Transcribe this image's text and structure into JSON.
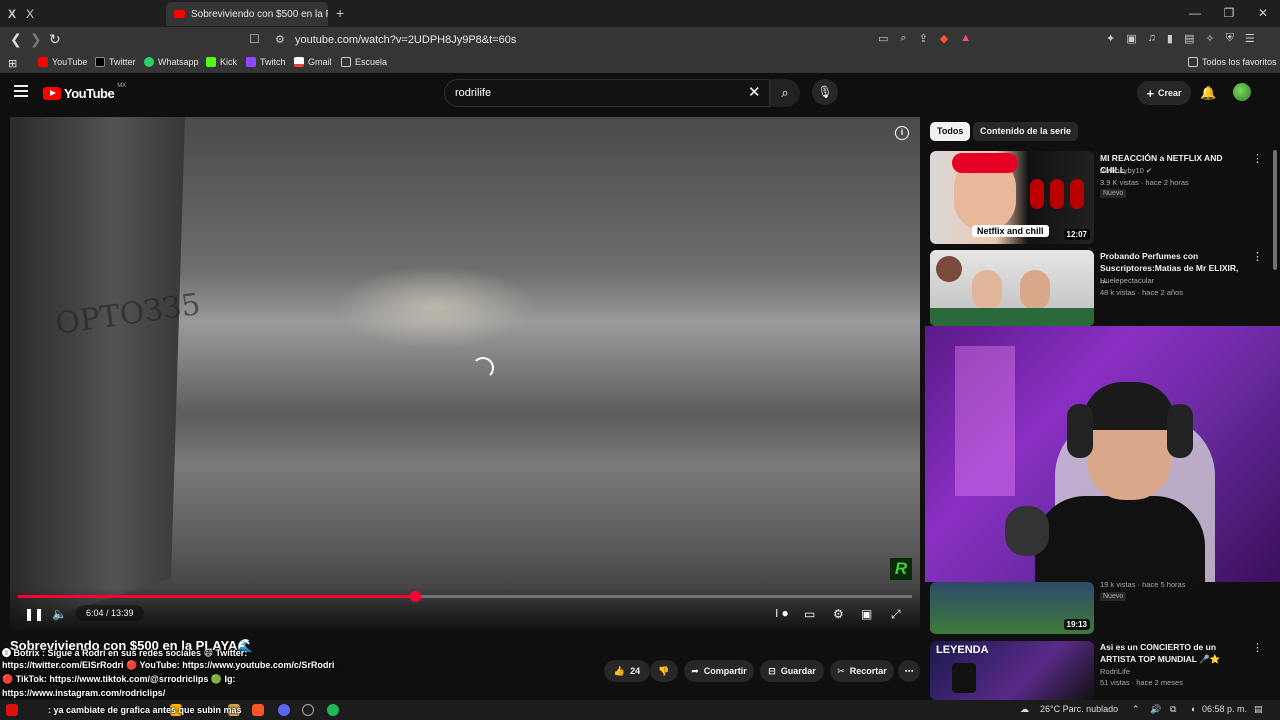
{
  "browser": {
    "pinned_tab_label": "X",
    "tab_title": "Sobreviviendo con $500 en la PL",
    "url": "youtube.com/watch?v=2UDPH8Jy9P8&t=60s",
    "bookmarks": [
      {
        "label": "YouTube",
        "color": "#ff0000"
      },
      {
        "label": "Twitter",
        "color": "#000000"
      },
      {
        "label": "Whatsapp",
        "color": "#25d366"
      },
      {
        "label": "Kick",
        "color": "#53fc18"
      },
      {
        "label": "Twitch",
        "color": "#9146ff"
      },
      {
        "label": "Gmail",
        "color": "#ea4335"
      },
      {
        "label": "Escuela",
        "color": "#cccccc"
      }
    ],
    "all_favorites": "Todos los favoritos"
  },
  "youtube": {
    "logo_text": "YouTube",
    "logo_region": "MX",
    "search_value": "rodrilife",
    "create_label": "Crear"
  },
  "player": {
    "time_display": "6:04 / 13:39",
    "progress_fraction": 0.444,
    "wall_graffiti": "ОРТОЗЗ5",
    "channel_mark": "R"
  },
  "video": {
    "title": "Sobreviviendo con $500 en la PLAYA🌊",
    "likes": "24",
    "share_label": "Compartir",
    "save_label": "Guardar",
    "clip_label": "Recortar"
  },
  "chat_overlay": {
    "lines": [
      "🅧 Botrix : Sigue a Rodri en sus redes sociales 😄 Twitter:",
      "https://twitter.com/ElSrRodri 🔴 YouTube: https://www.youtube.com/c/SrRodri",
      "🔴 TikTok: https://www.tiktok.com/@srrodriclips 🟢 Ig:",
      "https://www.instagram.com/rodriclips/",
      ": ya cambiate de grafica antes que subin mas"
    ]
  },
  "sidebar": {
    "chips": [
      "Todos",
      "Contenido de la serie"
    ],
    "recommendations": [
      {
        "title": "MI REACCIÓN a NETFLIX AND CHILL",
        "channel": "Anthonyby10 ✔",
        "meta": "3.9 K vistas · hace 2 horas",
        "badge": "Nuevo",
        "duration": "12:07",
        "thumb_text": "Netflix and chill"
      },
      {
        "title": "Probando Perfumes con Suscriptores:Matias de Mr ELIXIR, ...",
        "channel": "Huelepectacular",
        "meta": "48 k vistas · hace 2 años",
        "badge": "",
        "duration": "",
        "thumb_text": ""
      },
      {
        "title": "",
        "channel": "",
        "meta": "19 k vistas · hace 5 horas",
        "badge": "Nuevo",
        "duration": "19:13",
        "thumb_text": ""
      },
      {
        "title": "Asi es un CONCIERTO de un ARTISTA TOP MUNDIAL 🎤⭐",
        "channel": "RodriLife",
        "meta": "51 vistas · hace 2 meses",
        "badge": "",
        "duration": "",
        "thumb_text": "LEYENDA"
      }
    ]
  },
  "taskbar": {
    "weather": "26°C  Parc. nublado",
    "clock": "06:58 p. m."
  }
}
